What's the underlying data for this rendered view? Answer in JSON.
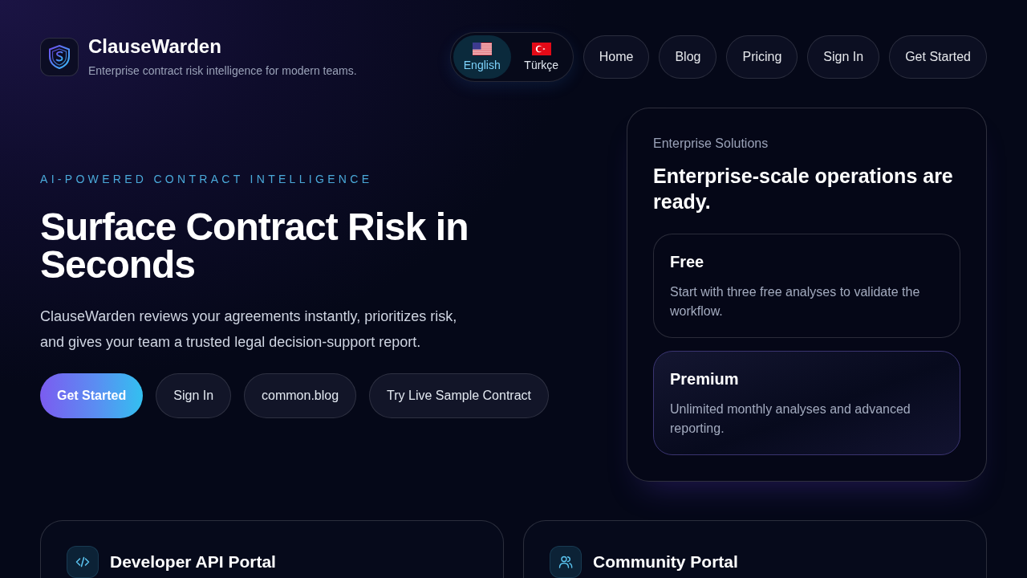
{
  "brand": {
    "name": "ClauseWarden",
    "tagline": "Enterprise contract risk intelligence for modern teams."
  },
  "languages": [
    {
      "label": "English",
      "selected": true
    },
    {
      "label": "Türkçe",
      "selected": false
    }
  ],
  "nav": [
    "Home",
    "Blog",
    "Pricing",
    "Sign In",
    "Get Started"
  ],
  "hero": {
    "eyebrow": "AI-POWERED CONTRACT INTELLIGENCE",
    "title": "Surface Contract Risk in Seconds",
    "text": "ClauseWarden reviews your agreements instantly, prioritizes risk, and gives your team a trusted legal decision-support report.",
    "buttons": [
      {
        "label": "Get Started",
        "kind": "primary"
      },
      {
        "label": "Sign In",
        "kind": "secondary"
      },
      {
        "label": "common.blog",
        "kind": "secondary"
      },
      {
        "label": "Try Live Sample Contract",
        "kind": "secondary"
      }
    ]
  },
  "enterprise": {
    "label": "Enterprise Solutions",
    "title": "Enterprise-scale operations are ready.",
    "plans": [
      {
        "name": "Free",
        "text": "Start with three free analyses to validate the workflow.",
        "featured": false
      },
      {
        "name": "Premium",
        "text": "Unlimited monthly analyses and advanced reporting.",
        "featured": true
      }
    ]
  },
  "portals": [
    {
      "title": "Developer API Portal"
    },
    {
      "title": "Community Portal"
    }
  ]
}
